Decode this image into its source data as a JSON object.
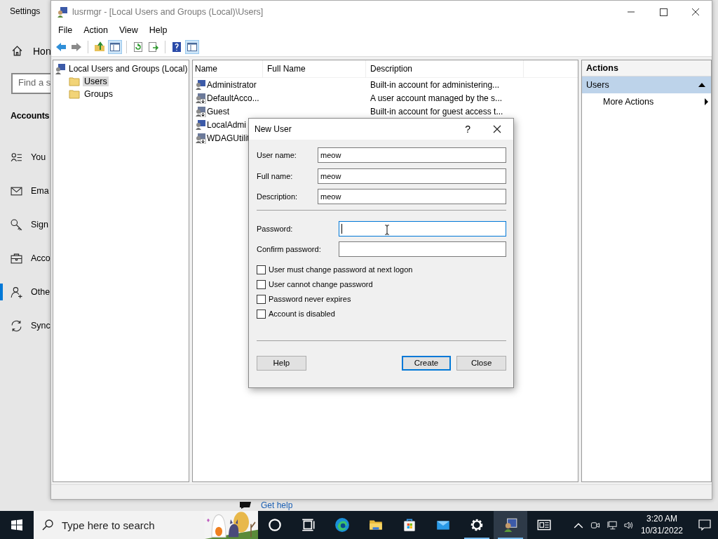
{
  "settings_window": {
    "title": "Settings",
    "home": "Hon",
    "search": {
      "placeholder": "Find a s"
    },
    "section": "Accounts",
    "items": [
      {
        "label": "You",
        "kind": "info",
        "selected": false
      },
      {
        "label": "Ema",
        "kind": "email",
        "selected": false
      },
      {
        "label": "Sign",
        "kind": "key",
        "selected": false
      },
      {
        "label": "Acco",
        "kind": "work",
        "selected": false
      },
      {
        "label": "Othe",
        "kind": "family",
        "selected": true
      },
      {
        "label": "Sync",
        "kind": "sync",
        "selected": false
      }
    ],
    "help_link": "Get help"
  },
  "mmc_window": {
    "title": "lusrmgr - [Local Users and Groups (Local)\\Users]",
    "menu": [
      "File",
      "Action",
      "View",
      "Help"
    ],
    "toolbar": [
      {
        "kind": "back",
        "pressed": false
      },
      {
        "kind": "forward",
        "pressed": false
      },
      {
        "kind": "up",
        "pressed": false
      },
      {
        "kind": "tree",
        "pressed": true
      },
      {
        "kind": "refresh",
        "pressed": false
      },
      {
        "kind": "export",
        "pressed": false
      },
      {
        "kind": "help",
        "pressed": false
      },
      {
        "kind": "actionpane",
        "pressed": true
      }
    ],
    "tree": {
      "label": "Local Users and Groups (Local)",
      "children": [
        {
          "label": "Users",
          "selected": true
        },
        {
          "label": "Groups",
          "selected": false
        }
      ]
    },
    "table": {
      "columns": [
        "Name",
        "Full Name",
        "Description"
      ],
      "rows": [
        {
          "name": "Administrator",
          "disabled": false,
          "description": "Built-in account for administering..."
        },
        {
          "name": "DefaultAcco...",
          "disabled": true,
          "description": "A user account managed by the s..."
        },
        {
          "name": "Guest",
          "disabled": true,
          "description": "Built-in account for guest access t..."
        },
        {
          "name": "LocalAdmi",
          "disabled": false
        },
        {
          "name": "WDAGUtilit",
          "disabled": true
        }
      ]
    },
    "actions": {
      "title": "Actions",
      "sections": [
        {
          "label": "Users",
          "expanded": true,
          "items": [
            "More Actions"
          ]
        }
      ]
    }
  },
  "dialog": {
    "title": "New User",
    "help_glyph": "?",
    "fields": [
      {
        "label": "User name:",
        "value": "meow"
      },
      {
        "label": "Full name:",
        "value": "meow"
      },
      {
        "label": "Description:",
        "value": "meow"
      }
    ],
    "password_fields": [
      {
        "label": "Password:",
        "focused": true
      },
      {
        "label": "Confirm password:",
        "focused": false
      }
    ],
    "checkboxes": [
      {
        "label": "User must change password at next logon",
        "checked": false
      },
      {
        "label": "User cannot change password",
        "checked": false
      },
      {
        "label": "Password never expires",
        "checked": false
      },
      {
        "label": "Account is disabled",
        "checked": false
      }
    ],
    "buttons": [
      {
        "label": "Help",
        "default": false
      },
      {
        "label": "Create",
        "default": true
      },
      {
        "label": "Close",
        "default": false
      }
    ]
  },
  "taskbar": {
    "search_placeholder": "Type here to search",
    "apps": [
      {
        "kind": "cortana",
        "running": false,
        "active": false
      },
      {
        "kind": "taskview",
        "running": false,
        "active": false
      },
      {
        "kind": "edge",
        "running": false,
        "active": false
      },
      {
        "kind": "explorer",
        "running": false,
        "active": false
      },
      {
        "kind": "store",
        "running": false,
        "active": false
      },
      {
        "kind": "mail",
        "running": false,
        "active": false
      },
      {
        "kind": "settings",
        "running": true,
        "active": false
      },
      {
        "kind": "users",
        "running": true,
        "active": true
      },
      {
        "kind": "news",
        "running": false,
        "active": false
      }
    ],
    "clock": {
      "time": "3:20 AM",
      "date": "10/31/2022"
    }
  }
}
